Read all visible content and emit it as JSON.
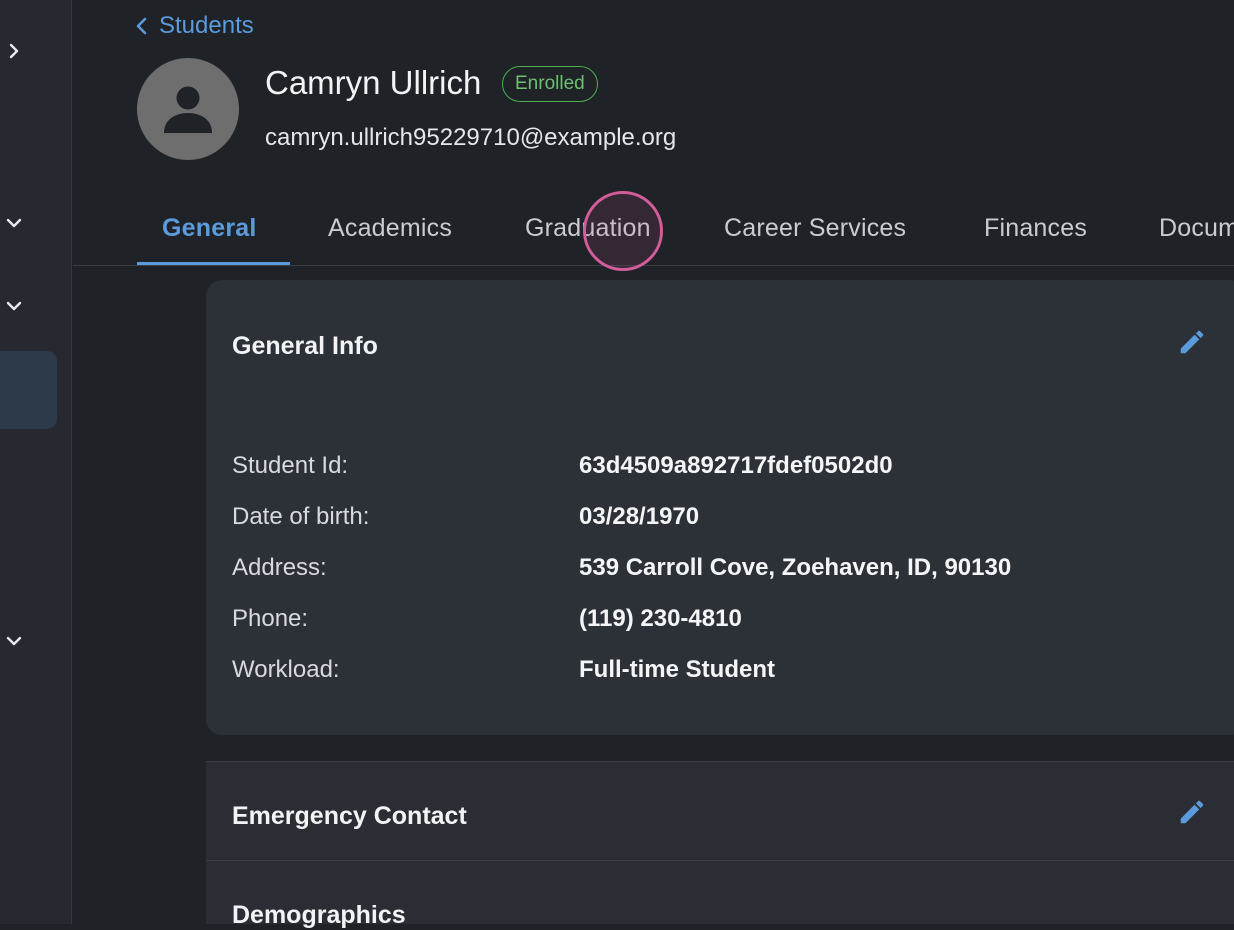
{
  "sidebar": {
    "expand_icon": "chevron-right-icon",
    "group_icons": [
      "chevron-down-icon",
      "chevron-down-icon",
      "chevron-down-icon"
    ]
  },
  "header": {
    "back_label": "Students",
    "name": "Camryn Ullrich",
    "status": "Enrolled",
    "email": "camryn.ullrich95229710@example.org"
  },
  "tabs": [
    {
      "label": "General",
      "active": true
    },
    {
      "label": "Academics",
      "active": false
    },
    {
      "label": "Graduation",
      "active": false
    },
    {
      "label": "Career Services",
      "active": false
    },
    {
      "label": "Finances",
      "active": false
    },
    {
      "label": "Documents",
      "active": false
    }
  ],
  "general_info": {
    "title": "General Info",
    "rows": [
      {
        "label": "Student Id:",
        "value": "63d4509a892717fdef0502d0"
      },
      {
        "label": "Date of birth:",
        "value": "03/28/1970"
      },
      {
        "label": "Address:",
        "value": "539 Carroll Cove, Zoehaven, ID, 90130"
      },
      {
        "label": "Phone:",
        "value": "(119) 230-4810"
      },
      {
        "label": "Workload:",
        "value": "Full-time Student"
      }
    ]
  },
  "sections": {
    "emergency_contact": "Emergency Contact",
    "demographics": "Demographics"
  },
  "colors": {
    "accent": "#5b9bdc",
    "status_green": "#4caf50",
    "background": "#1f2227",
    "card": "#2c3037",
    "click_marker": "#d25d9a"
  }
}
